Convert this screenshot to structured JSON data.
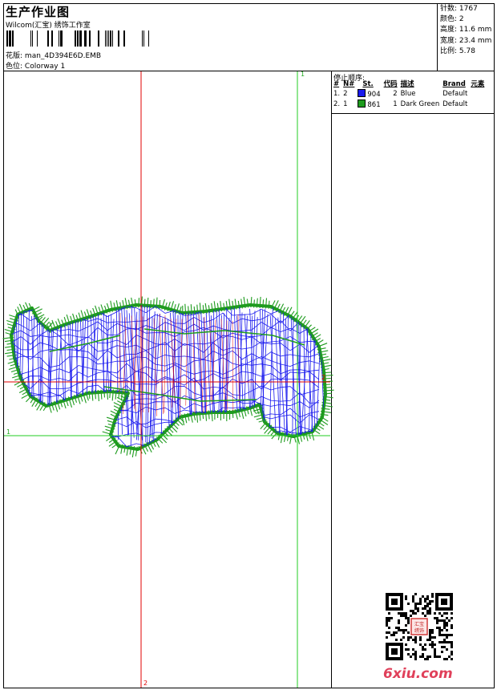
{
  "header": {
    "title": "生产作业图",
    "studio": "Wilcom(汇宝) 绣饰工作室",
    "design_label": "花版:",
    "design_value": "man_4D394E6D.EMB",
    "colorway_label": "色位:",
    "colorway_value": "Colorway 1"
  },
  "stats": [
    {
      "label": "针数:",
      "value": "1767"
    },
    {
      "label": "颜色:",
      "value": "2"
    },
    {
      "label": "高度:",
      "value": "11.6 mm"
    },
    {
      "label": "宽度:",
      "value": "23.4 mm"
    },
    {
      "label": "比例:",
      "value": "5.78"
    }
  ],
  "stop_sequence": {
    "title": "停止顺序:",
    "columns": [
      "#",
      "N#",
      "St.",
      "代码",
      "描述",
      "Brand",
      "元素"
    ],
    "rows": [
      {
        "idx": "1.",
        "n": "2",
        "color": "#1a1aee",
        "code": "904",
        "st": "2",
        "desc": "Blue",
        "brand": "Default"
      },
      {
        "idx": "2.",
        "n": "1",
        "color": "#1e9b1e",
        "code": "861",
        "st": "1",
        "desc": "Dark Green",
        "brand": "Default"
      }
    ]
  },
  "axis_labels": {
    "green_vertical_top": "1",
    "green_horizontal_left": "1",
    "red_horizontal_right": "2",
    "red_vertical_bottom": "2"
  },
  "colors": {
    "blue_thread": "#1a1aee",
    "green_thread": "#1e9b1e",
    "red_axis": "#e00000",
    "green_axis": "#22cc22"
  },
  "watermark": {
    "site": "6xiu.com",
    "seal_text": "汇宝绣饰"
  }
}
